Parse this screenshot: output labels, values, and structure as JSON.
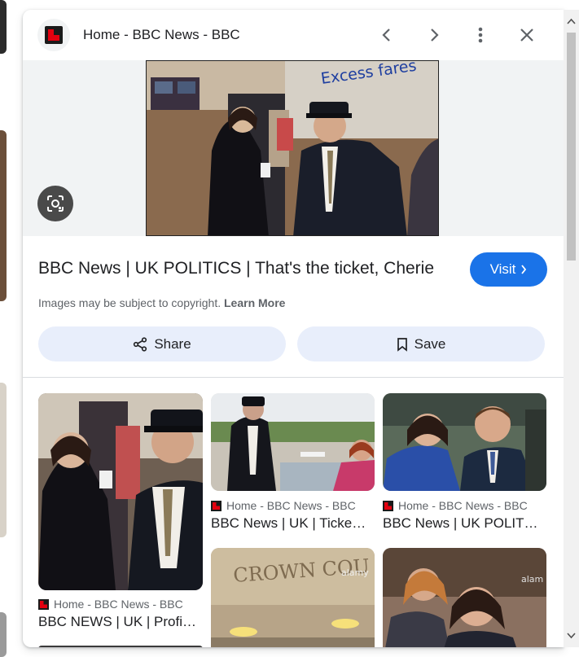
{
  "header": {
    "site_title": "Home - BBC News - BBC",
    "icons": [
      "bbc-logo-icon",
      "chevron-left-icon",
      "chevron-right-icon",
      "more-vert-icon",
      "close-icon"
    ]
  },
  "preview": {
    "image_sign_text": "Excess fares",
    "lens_icon": "google-lens-icon"
  },
  "result": {
    "title": "BBC News | UK POLITICS | That's the ticket, Cherie",
    "visit_label": "Visit",
    "copyright_text": "Images may be subject to copyright.",
    "learn_more_label": "Learn More"
  },
  "actions": {
    "share_label": "Share",
    "save_label": "Save"
  },
  "related": [
    {
      "source": "Home - BBC News - BBC",
      "caption": "BBC NEWS | UK | Profi…"
    },
    {
      "source": "Home - BBC News - BBC",
      "caption": "BBC News | UK | Ticke…"
    },
    {
      "source": "Home - BBC News - BBC",
      "caption": "BBC News | UK POLIT…"
    },
    {
      "sign_text": "CROWN COU",
      "watermark": "alamy"
    },
    {
      "watermark": "alam"
    }
  ],
  "colors": {
    "accent": "#1a73e8",
    "action_bg": "#e8eefb",
    "bbc_red": "#e3000f"
  }
}
